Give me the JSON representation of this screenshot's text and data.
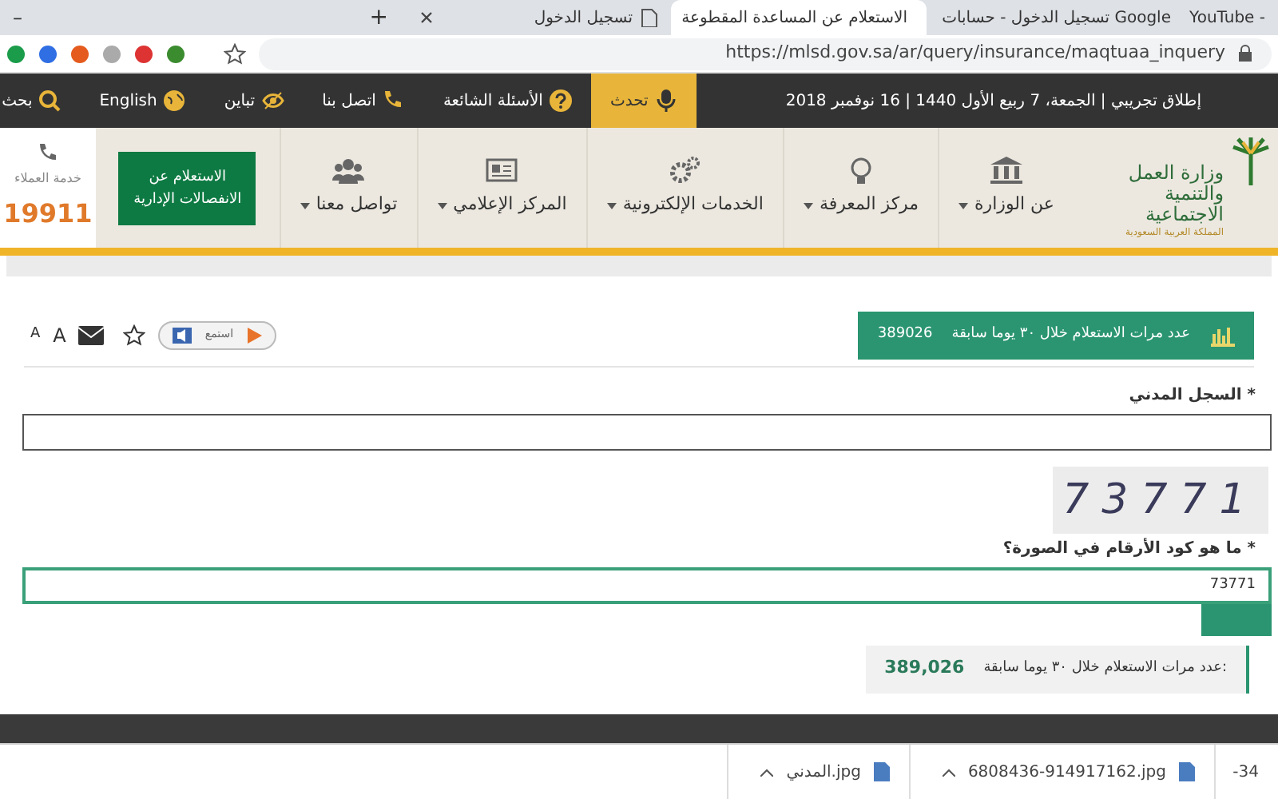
{
  "browser": {
    "tabs": [
      {
        "title": "YouTube -",
        "selected": false
      },
      {
        "title": "تسجيل الدخول - حسابات Google",
        "selected": false
      },
      {
        "title": "الاستعلام عن المساعدة المقطوعة",
        "selected": true
      },
      {
        "title": "تسجيل الدخول",
        "selected": false
      }
    ],
    "new_tab": "+",
    "minimize": "–",
    "url": "https://mlsd.gov.sa/ar/query/insurance/maqtuaa_inquery"
  },
  "top_bar": {
    "date": "إطلاق تجريبي | الجمعة، 7 ربيع الأول 1440 | 16 نوفمبر 2018",
    "links": [
      {
        "label": "تحدث",
        "kind": "speak"
      },
      {
        "label": "الأسئلة الشائعة",
        "kind": "faq"
      },
      {
        "label": "اتصل بنا",
        "kind": "phone"
      },
      {
        "label": "تباين",
        "kind": "contrast"
      },
      {
        "label": "English",
        "kind": "globe"
      },
      {
        "label": "بحث",
        "kind": "search"
      }
    ]
  },
  "header": {
    "logo": {
      "name": "وزارة العمل والتنمية الاجتماعية",
      "country": "المملكة العربية السعودية"
    },
    "menu": [
      {
        "label": "عن الوزارة",
        "kind": "bank"
      },
      {
        "label": "مركز المعرفة",
        "kind": "bulb"
      },
      {
        "label": "الخدمات الإلكترونية",
        "kind": "gears"
      },
      {
        "label": "المركز الإعلامي",
        "kind": "news"
      },
      {
        "label": "تواصل معنا",
        "kind": "people"
      }
    ],
    "cta": "الاستعلام عن الانفصالات الإدارية",
    "support": {
      "label": "خدمة العملاء",
      "number": "19911"
    }
  },
  "toolbar": {
    "listen": "استمع",
    "font_large": "A",
    "font_small": "A",
    "counter": {
      "label": "عدد مرات الاستعلام خلال ٣٠ يوما سابقة",
      "value": "389026"
    }
  },
  "form": {
    "fields": [
      {
        "label": "السجل المدني *",
        "focused": false
      },
      {
        "label": "ما هو كود الأرقام في الصورة؟ *",
        "value": "73771",
        "focused": true
      }
    ],
    "captcha": "73771"
  },
  "stats": {
    "label": "عدد مرات الاستعلام خلال ٣٠ يوما سابقة:",
    "value": "389,026"
  },
  "downloads": [
    {
      "name": "-34"
    },
    {
      "name": "6808436-914917162.jpg"
    },
    {
      "name": "المدني.jpg"
    }
  ]
}
